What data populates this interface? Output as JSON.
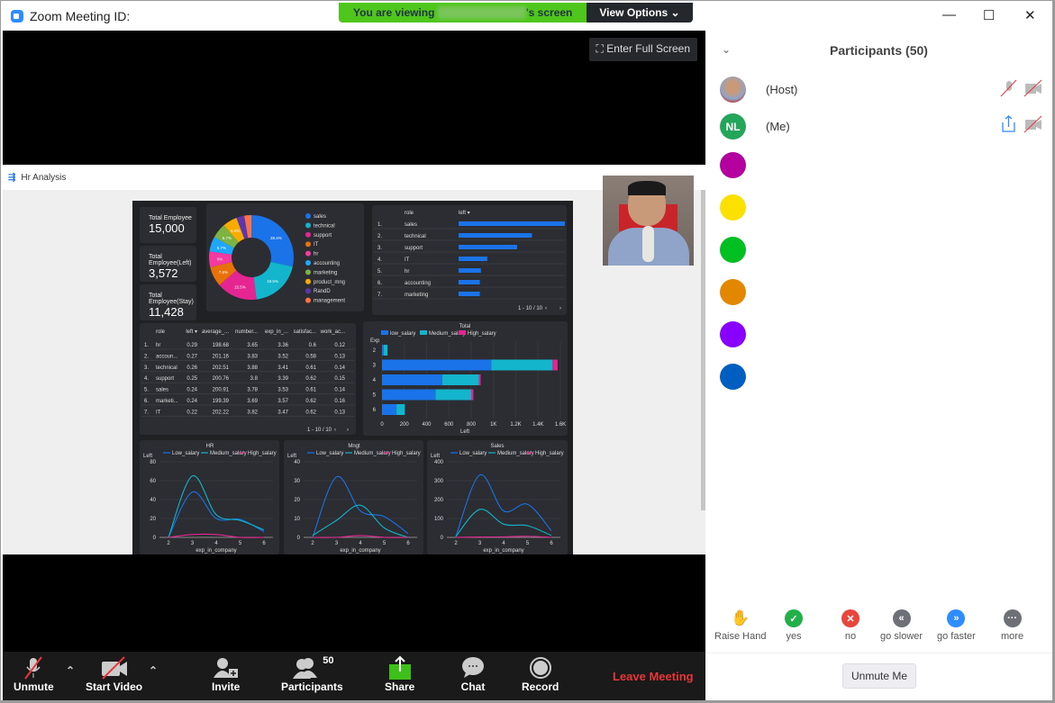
{
  "window": {
    "title": "Zoom Meeting ID:",
    "controls": {
      "minimize": "—",
      "maximize": "☐",
      "close": "✕"
    }
  },
  "banner": {
    "prefix": "You are viewing",
    "suffix": "'s screen",
    "view_options": "View Options ⌄"
  },
  "video": {
    "fullscreen_label": "Enter Full Screen"
  },
  "shared_screen": {
    "app_title": "Hr Analysis",
    "kpis": [
      {
        "label": "Total Employee",
        "value": "15,000"
      },
      {
        "label": "Total Employee(Left)",
        "value": "3,572"
      },
      {
        "label": "Total Employee(Stay)",
        "value": "11,428"
      }
    ],
    "donut": {
      "legend": [
        "sales",
        "technical",
        "support",
        "IT",
        "hr",
        "accounting",
        "marketing",
        "product_mng",
        "RandD",
        "management"
      ],
      "colors": [
        "#1a73e8",
        "#12b5cb",
        "#e52592",
        "#e8710a",
        "#f439a0",
        "#1ea7fd",
        "#7cb342",
        "#f9ab00",
        "#5e35b1",
        "#ff7043"
      ],
      "values": [
        28.4,
        19.5,
        15.5,
        7.6,
        6,
        5.7,
        5.7,
        5.5,
        3,
        2.7
      ],
      "labels": [
        "28.4%",
        "19.5%",
        "15.5%",
        "7.6%",
        "6%",
        "5.7%",
        "5.7%",
        "5.5%",
        "",
        ""
      ]
    },
    "role_table": {
      "headers": [
        "role",
        "left ▾"
      ],
      "rows": [
        [
          "1.",
          "sales",
          1.0
        ],
        [
          "2.",
          "technical",
          0.69
        ],
        [
          "3.",
          "support",
          0.55
        ],
        [
          "4.",
          "IT",
          0.27
        ],
        [
          "5.",
          "hr",
          0.21
        ],
        [
          "6.",
          "accounting",
          0.2
        ],
        [
          "7.",
          "marketing",
          0.2
        ]
      ],
      "pager": "1 - 10 / 10"
    },
    "stats_table": {
      "headers": [
        "role",
        "left ▾",
        "average_...",
        "number...",
        "exp_in_...",
        "satisfac...",
        "work_ac..."
      ],
      "rows": [
        [
          "1.",
          "hr",
          "0.29",
          "198.68",
          "3.65",
          "3.36",
          "0.6",
          "0.12"
        ],
        [
          "2.",
          "accoun...",
          "0.27",
          "201.16",
          "3.83",
          "3.52",
          "0.58",
          "0.13"
        ],
        [
          "3.",
          "technical",
          "0.26",
          "202.51",
          "3.88",
          "3.41",
          "0.61",
          "0.14"
        ],
        [
          "4.",
          "support",
          "0.25",
          "200.76",
          "3.8",
          "3.39",
          "0.62",
          "0.15"
        ],
        [
          "5.",
          "sales",
          "0.24",
          "200.91",
          "3.78",
          "3.53",
          "0.61",
          "0.14"
        ],
        [
          "6.",
          "marketi...",
          "0.24",
          "199.39",
          "3.69",
          "3.57",
          "0.62",
          "0.16"
        ],
        [
          "7.",
          "IT",
          "0.22",
          "202.22",
          "3.82",
          "3.47",
          "0.62",
          "0.13"
        ]
      ],
      "pager": "1 - 10 / 10"
    }
  },
  "chart_data": [
    {
      "type": "bar",
      "orientation": "horizontal",
      "stacked": true,
      "title": "Total",
      "xlabel": "Left",
      "ylabel": "Exp",
      "categories": [
        "2",
        "3",
        "4",
        "5",
        "6"
      ],
      "series": [
        {
          "name": "low_salary",
          "color": "#1a73e8",
          "values": [
            15,
            980,
            540,
            480,
            130
          ]
        },
        {
          "name": "Medium_salary",
          "color": "#12b5cb",
          "values": [
            35,
            550,
            330,
            320,
            75
          ]
        },
        {
          "name": "High_salary",
          "color": "#e52592",
          "values": [
            0,
            45,
            15,
            20,
            0
          ]
        }
      ],
      "xlim": [
        0,
        1600
      ],
      "xticks": [
        "0",
        "200",
        "400",
        "600",
        "800",
        "1K",
        "1.2K",
        "1.4K",
        "1.6K"
      ]
    },
    {
      "type": "line",
      "title": "HR",
      "xlabel": "exp_in_company",
      "ylabel": "Left",
      "x": [
        2,
        3,
        4,
        5,
        6
      ],
      "ylim": [
        0,
        80
      ],
      "yticks": [
        0,
        20,
        40,
        60,
        80
      ],
      "series": [
        {
          "name": "Low_salary",
          "color": "#1a73e8",
          "values": [
            0,
            48,
            20,
            19,
            6
          ]
        },
        {
          "name": "Medium_salary",
          "color": "#12b5cb",
          "values": [
            0,
            65,
            24,
            18,
            8
          ]
        },
        {
          "name": "High_salary",
          "color": "#e52592",
          "values": [
            0,
            3,
            3,
            0,
            0
          ]
        }
      ]
    },
    {
      "type": "line",
      "title": "Mngt",
      "xlabel": "exp_in_company",
      "ylabel": "Left",
      "x": [
        2,
        3,
        4,
        5,
        6
      ],
      "ylim": [
        0,
        40
      ],
      "yticks": [
        0,
        10,
        20,
        30,
        40
      ],
      "series": [
        {
          "name": "Low_salary",
          "color": "#1a73e8",
          "values": [
            0,
            32,
            14,
            11,
            2
          ]
        },
        {
          "name": "Medium_salary",
          "color": "#12b5cb",
          "values": [
            1,
            9,
            17,
            5,
            0
          ]
        },
        {
          "name": "High_salary",
          "color": "#e52592",
          "values": [
            0,
            0,
            1,
            0,
            0
          ]
        }
      ]
    },
    {
      "type": "line",
      "title": "Sales",
      "xlabel": "exp_in_company",
      "ylabel": "Left",
      "x": [
        2,
        3,
        4,
        5,
        6
      ],
      "ylim": [
        0,
        400
      ],
      "yticks": [
        0,
        100,
        200,
        300,
        400
      ],
      "series": [
        {
          "name": "Low_salary",
          "color": "#1a73e8",
          "values": [
            5,
            330,
            140,
            175,
            35
          ]
        },
        {
          "name": "Medium_salary",
          "color": "#12b5cb",
          "values": [
            5,
            148,
            70,
            62,
            10
          ]
        },
        {
          "name": "High_salary",
          "color": "#e52592",
          "values": [
            0,
            2,
            3,
            6,
            0
          ]
        }
      ]
    }
  ],
  "toolbar": {
    "unmute": "Unmute",
    "start_video": "Start Video",
    "invite": "Invite",
    "participants": "Participants",
    "participants_count": "50",
    "share": "Share",
    "chat": "Chat",
    "record": "Record",
    "leave": "Leave Meeting"
  },
  "participants": {
    "title": "Participants (50)",
    "list": [
      {
        "name": "(Host)",
        "type": "photo"
      },
      {
        "name": "(Me)",
        "initials": "NL",
        "color": "#23a55a"
      },
      {
        "color": "#b4009e"
      },
      {
        "color": "#fce100"
      },
      {
        "color": "#00bf21"
      },
      {
        "color": "#e38600"
      },
      {
        "color": "#8800ff"
      },
      {
        "color": "#005ec0"
      }
    ],
    "reactions": [
      {
        "label": "Raise Hand",
        "color": "#2d8cff",
        "glyph": "✋"
      },
      {
        "label": "yes",
        "color": "#23b04a",
        "glyph": "✓"
      },
      {
        "label": "no",
        "color": "#e8453c",
        "glyph": "✕"
      },
      {
        "label": "go slower",
        "color": "#6e7078",
        "glyph": "«"
      },
      {
        "label": "go faster",
        "color": "#2d8cff",
        "glyph": "»"
      },
      {
        "label": "more",
        "color": "#6e7078",
        "glyph": "···"
      }
    ],
    "unmute_me": "Unmute Me"
  }
}
